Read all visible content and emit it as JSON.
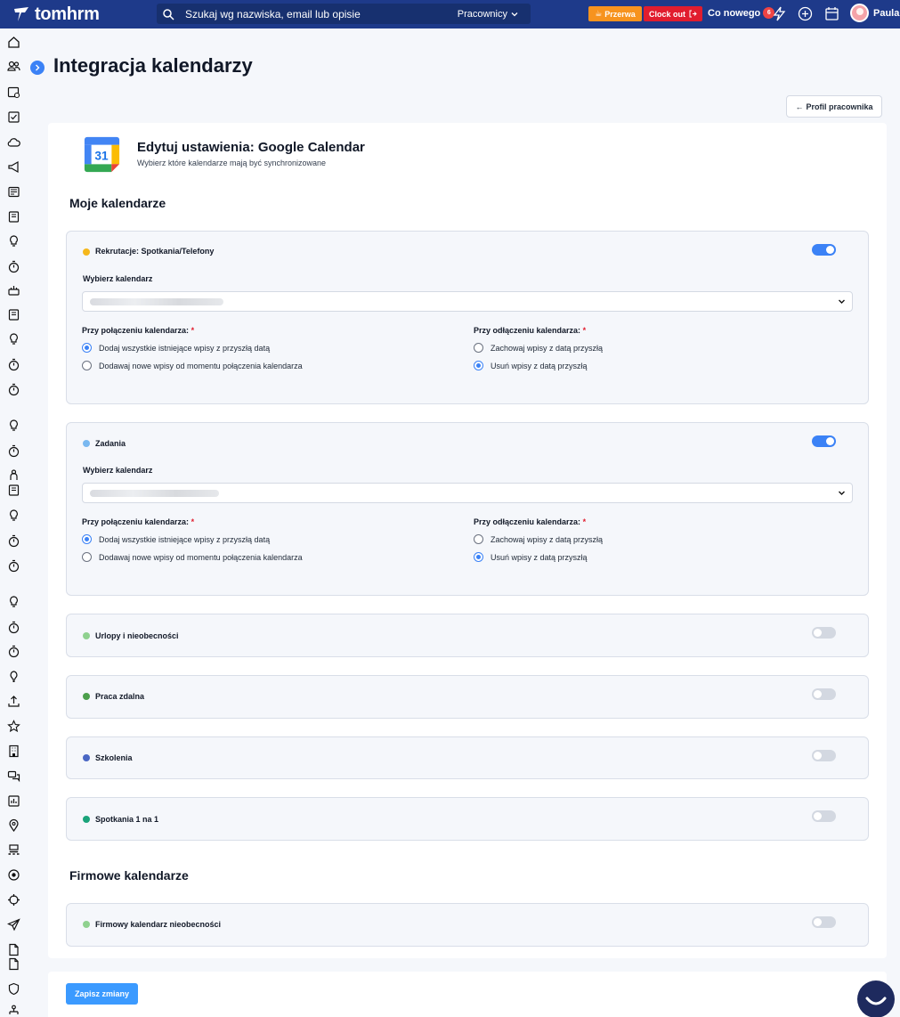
{
  "app": {
    "name": "tomhrm"
  },
  "search": {
    "placeholder": "Szukaj wg nazwiska, email lub opisie",
    "scope": "Pracownicy"
  },
  "topbar": {
    "break_label": "Przerwa",
    "clock_out_label": "Clock out",
    "whats_new_label": "Co nowego",
    "whats_new_count": "6",
    "user_name": "Paula"
  },
  "page": {
    "title": "Integracja kalendarzy",
    "back_label": "Profil pracownika"
  },
  "card": {
    "calendar_day": "31",
    "title": "Edytuj ustawienia: Google Calendar",
    "subtitle": "Wybierz które kalendarze mają być synchronizowane"
  },
  "sections": {
    "my_calendars": "Moje kalendarze",
    "company_calendars": "Firmowe kalendarze"
  },
  "form": {
    "select_label": "Wybierz kalendarz",
    "on_connect_label": "Przy połączeniu kalendarza:",
    "on_disconnect_label": "Przy odłączeniu kalendarza:",
    "required_mark": "*",
    "connect_opt_1": "Dodaj wszystkie istniejące wpisy z przyszłą datą",
    "connect_opt_2": "Dodawaj nowe wpisy od momentu połączenia kalendarza",
    "disconnect_opt_1": "Zachowaj wpisy z datą przyszłą",
    "disconnect_opt_2": "Usuń wpisy z datą przyszłą"
  },
  "calendars": [
    {
      "name": "Rekrutacje: Spotkania/Telefony",
      "color": "#f5b71b",
      "enabled": true
    },
    {
      "name": "Zadania",
      "color": "#79b8f0",
      "enabled": true
    },
    {
      "name": "Urlopy i nieobecności",
      "color": "#8fd18f",
      "enabled": false
    },
    {
      "name": "Praca zdalna",
      "color": "#4c9f4c",
      "enabled": false
    },
    {
      "name": "Szkolenia",
      "color": "#4a67c4",
      "enabled": false
    },
    {
      "name": "Spotkania 1 na 1",
      "color": "#1aa37a",
      "enabled": false
    }
  ],
  "company_calendars": [
    {
      "name": "Firmowy kalendarz nieobecności",
      "color": "#8fd18f",
      "enabled": false
    }
  ],
  "footer": {
    "save_label": "Zapisz zmiany"
  },
  "colors": {
    "topbar": "#1e3a8a",
    "accent": "#3b82f6",
    "break": "#f7931e",
    "clock_out": "#e11d2e"
  }
}
